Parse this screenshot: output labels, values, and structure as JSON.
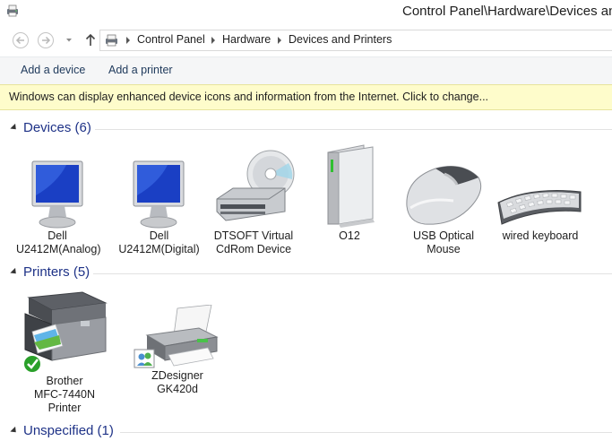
{
  "window": {
    "title": "Control Panel\\Hardware\\Devices and Printers"
  },
  "address": {
    "crumbs": [
      "Control Panel",
      "Hardware",
      "Devices and Printers"
    ]
  },
  "commands": {
    "add_device": "Add a device",
    "add_printer": "Add a printer"
  },
  "infobar": {
    "text": "Windows can display enhanced device icons and information from the Internet. Click to change..."
  },
  "groups": {
    "devices": {
      "title": "Devices (6)",
      "items": [
        {
          "line1": "Dell",
          "line2": "U2412M(Analog)",
          "icon": "monitor-icon"
        },
        {
          "line1": "Dell",
          "line2": "U2412M(Digital)",
          "icon": "monitor-icon"
        },
        {
          "line1": "DTSOFT Virtual",
          "line2": "CdRom Device",
          "icon": "cd-drive-icon"
        },
        {
          "line1": "O12",
          "line2": "",
          "icon": "external-drive-icon"
        },
        {
          "line1": "USB Optical",
          "line2": "Mouse",
          "icon": "mouse-icon"
        },
        {
          "line1": "wired keyboard",
          "line2": "",
          "icon": "keyboard-icon"
        }
      ]
    },
    "printers": {
      "title": "Printers (5)",
      "items": [
        {
          "line1": "Brother",
          "line2": "MFC-7440N",
          "line3": "Printer",
          "icon": "multifunction-printer-icon"
        },
        {
          "line1": "ZDesigner",
          "line2": "GK420d",
          "line3": "",
          "icon": "printer-icon"
        }
      ]
    },
    "unspecified": {
      "title": "Unspecified (1)"
    }
  },
  "colors": {
    "group_title": "#1e3287",
    "infobar_bg": "#fefccb",
    "command_text": "#1e395b"
  }
}
